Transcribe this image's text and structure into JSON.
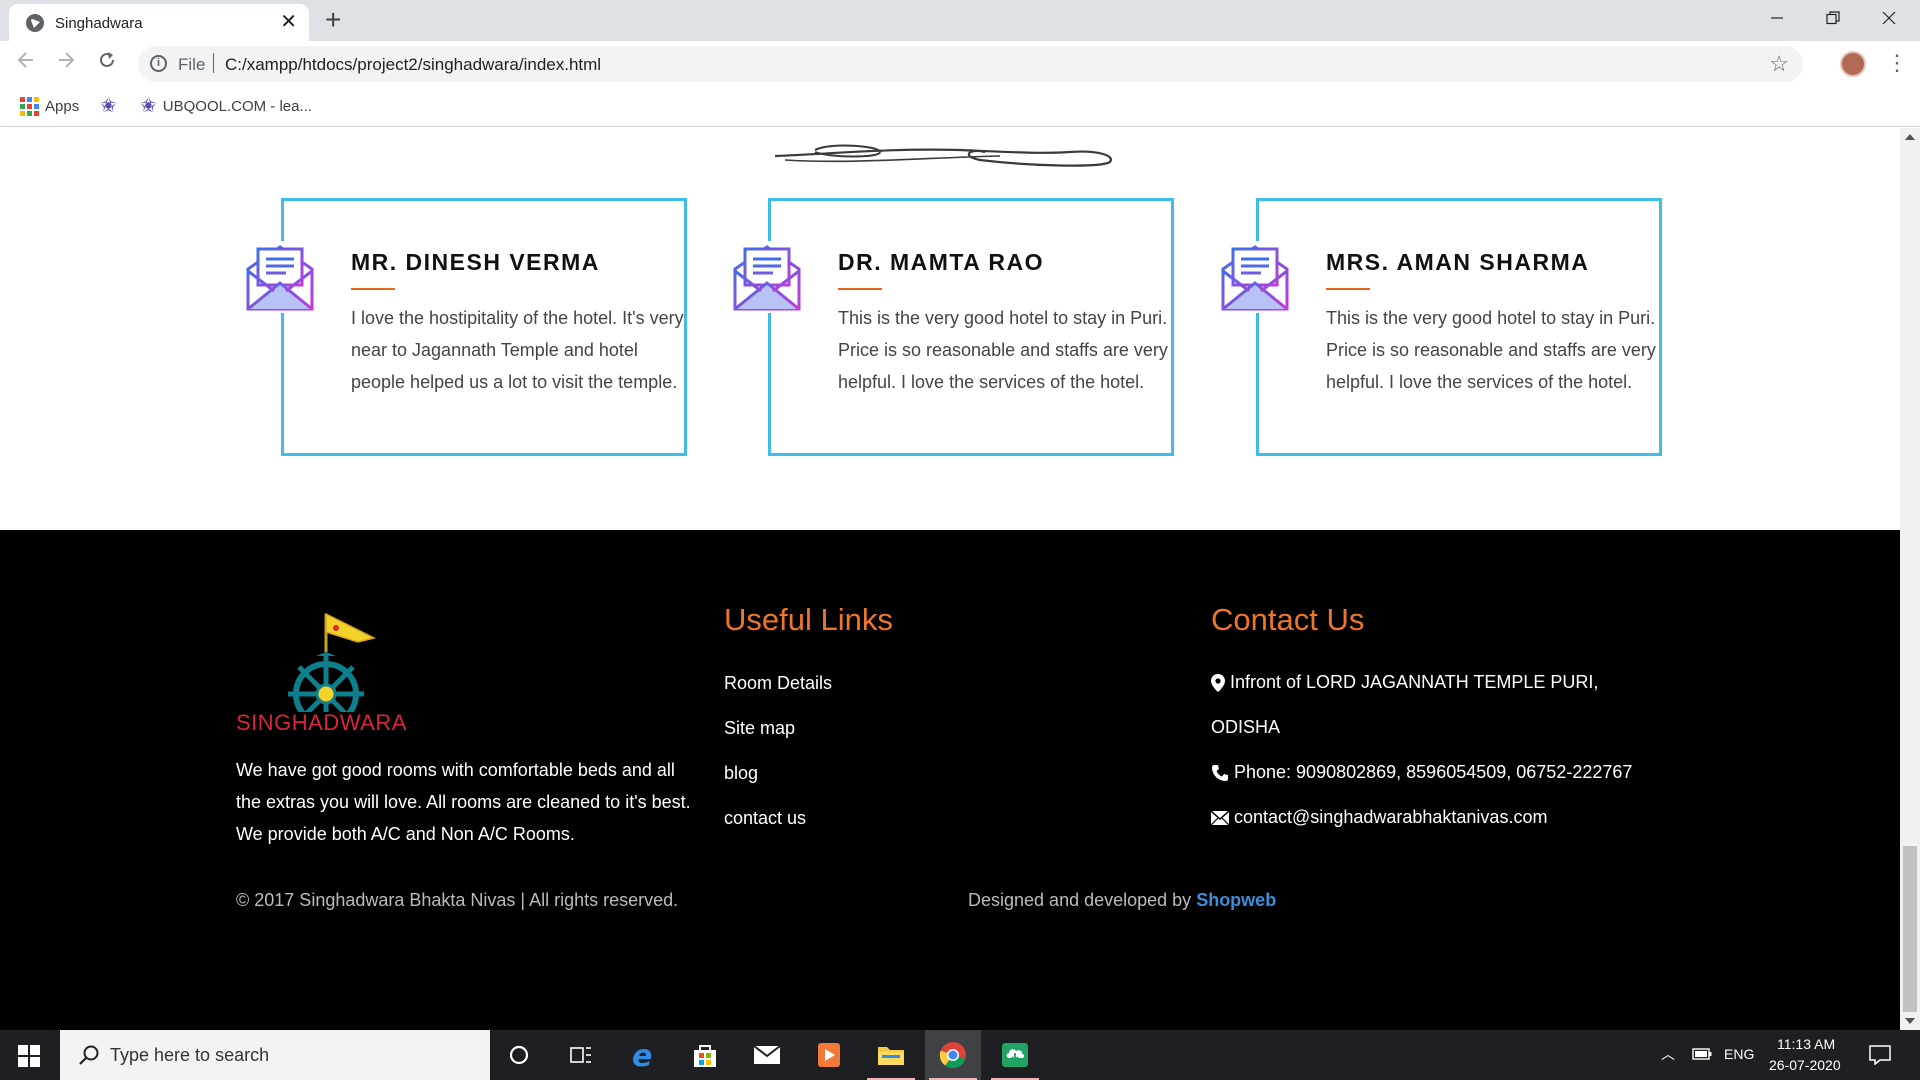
{
  "browser": {
    "tab_title": "Singhadwara",
    "tab_close": "✕",
    "new_tab": "+",
    "scheme": "File",
    "url": "C:/xampp/htdocs/project2/singhadwara/index.html",
    "bookmarks": [
      {
        "label": "Apps"
      },
      {
        "label": ""
      },
      {
        "label": "UBQOOL.COM - lea..."
      }
    ]
  },
  "testimonials": [
    {
      "name": "MR. DINESH VERMA",
      "text": "I love the hostipitality of the hotel. It's very near to Jagannath Temple and hotel people helped us a lot to visit the temple."
    },
    {
      "name": "DR. MAMTA RAO",
      "text": "This is the very good hotel to stay in Puri. Price is so reasonable and staffs are very helpful. I love the services of the hotel."
    },
    {
      "name": "MRS. AMAN SHARMA",
      "text": "This is the very good hotel to stay in Puri. Price is so reasonable and staffs are very helpful. I love the services of the hotel."
    }
  ],
  "footer": {
    "logo_text": "SINGHADWARA",
    "about": "We have got good rooms with comfortable beds and all the extras you will love. All rooms are cleaned to it's best. We provide both A/C and Non A/C Rooms.",
    "useful_links_title": "Useful Links",
    "links": [
      "Room Details",
      "Site map",
      "blog",
      "contact us"
    ],
    "contact_title": "Contact Us",
    "address_line1": "Infront of LORD JAGANNATH TEMPLE PURI,",
    "address_line2": "ODISHA",
    "phone": "Phone: 9090802869, 8596054509, 06752-222767",
    "email": "contact@singhadwarabhaktanivas.com",
    "copyright": "© 2017 Singhadwara Bhakta Nivas | All rights reserved.",
    "designed_prefix": "Designed and developed by",
    "designed_by": "Shopweb"
  },
  "taskbar": {
    "search_placeholder": "Type here to search",
    "language": "ENG",
    "time": "11:13 AM",
    "date": "26-07-2020"
  },
  "colors": {
    "card_border": "#3fbde6",
    "heading_orange": "#ee7629",
    "accent_link": "#3b8edc"
  }
}
